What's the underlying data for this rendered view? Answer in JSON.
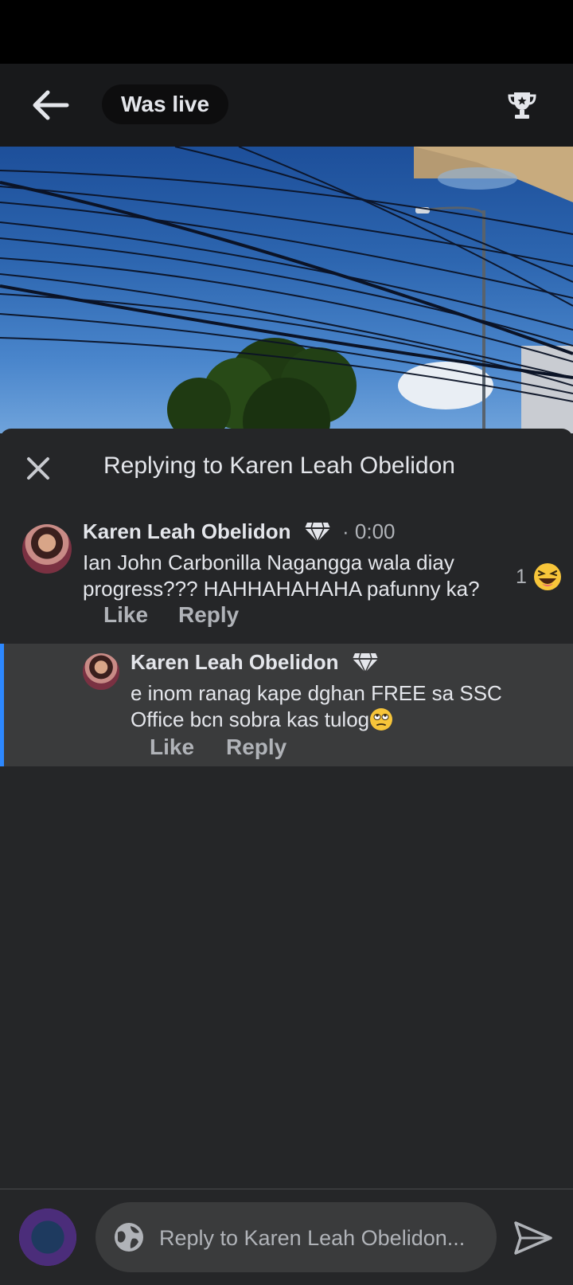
{
  "header": {
    "live_label": "Was live"
  },
  "reply_panel": {
    "title": "Replying to Karen Leah Obelidon"
  },
  "comment": {
    "author": "Karen Leah Obelidon",
    "timestamp": "· 0:00",
    "text": "Ian John Carbonilla Nagangga wala diay progress??? HAHHAHAHAHA pafunny ka?",
    "reaction_count": "1",
    "like_label": "Like",
    "reply_label": "Reply"
  },
  "reply": {
    "author": "Karen Leah Obelidon",
    "text": "e inom ranag kape dghan FREE sa SSC Office bcn sobra kas tulog",
    "like_label": "Like",
    "reply_label": "Reply"
  },
  "composer": {
    "placeholder": "Reply to Karen Leah Obelidon..."
  },
  "colors": {
    "background": "#252628",
    "selected_reply": "#3a3b3c",
    "accent": "#2d88ff"
  },
  "icons": [
    "back-arrow-icon",
    "trophy-icon",
    "close-icon",
    "top-fan-badge-icon",
    "laughing-emoji-icon",
    "eye-roll-emoji-icon",
    "globe-icon",
    "send-icon"
  ]
}
